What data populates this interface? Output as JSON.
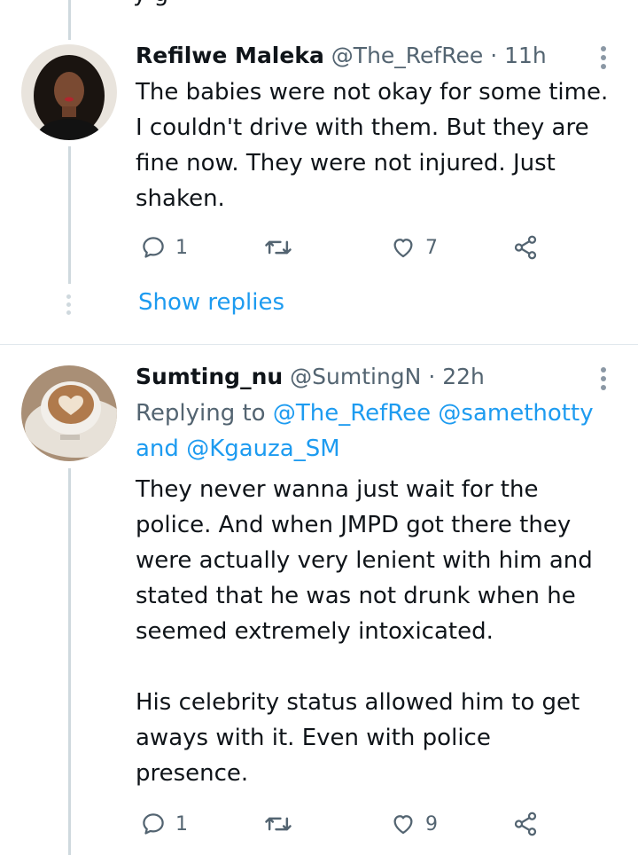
{
  "tweets": [
    {
      "name": "Refilwe Maleka",
      "handle": "@The_RefRee",
      "time": "· 11h",
      "lines": [
        "The babies were not okay for some time.",
        "I couldn't drive with them. But they are",
        "fine now. They were not injured. Just",
        "shaken."
      ],
      "replies": "1",
      "likes": "7",
      "show_replies": "Show replies"
    },
    {
      "name": "Sumting_nu",
      "handle": "@SumtingN",
      "time": "· 22h",
      "replying_prefix": "Replying to",
      "replying_user1": "@The_RefRee",
      "replying_user2": "@samethotty",
      "replying_and": "and",
      "replying_user3": "@Kgauza_SM",
      "lines": [
        "They never wanna just wait for the",
        "police. And when JMPD got there they",
        "were actually very lenient with him and",
        "stated that he was not drunk when he",
        "seemed extremely intoxicated.",
        "",
        "His celebrity status allowed him to get",
        "aways with it. Even with police",
        "presence."
      ],
      "replies": "1",
      "likes": "9"
    }
  ],
  "colors": {
    "accent": "#1d9bf0",
    "muted": "#536471",
    "text": "#0f1419"
  }
}
